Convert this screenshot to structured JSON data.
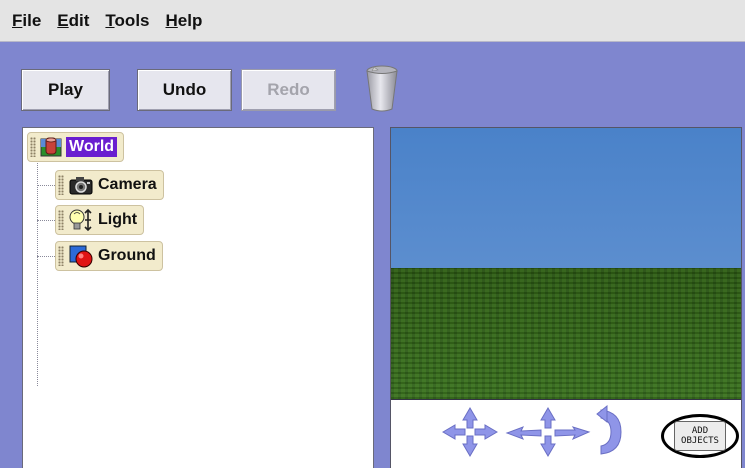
{
  "menubar": {
    "items": [
      "File",
      "Edit",
      "Tools",
      "Help"
    ]
  },
  "toolbar": {
    "play_label": "Play",
    "undo_label": "Undo",
    "redo_label": "Redo",
    "redo_enabled": false,
    "trash_icon": "trash-can-icon"
  },
  "object_tree": {
    "root": {
      "label": "World",
      "icon": "world-icon",
      "selected": true
    },
    "children": [
      {
        "label": "Camera",
        "icon": "camera-icon"
      },
      {
        "label": "Light",
        "icon": "lightbulb-icon"
      },
      {
        "label": "Ground",
        "icon": "ground-icon"
      }
    ]
  },
  "scene_view": {
    "sky_color": "#4f86cb",
    "ground_color": "#2f5f18",
    "controls": [
      "move-camera-icon",
      "move-camera-up-down-icon",
      "turn-camera-icon"
    ],
    "add_objects_label": "ADD OBJECTS"
  },
  "colors": {
    "background": "#7f86cf",
    "selection": "#6a1ed0",
    "tile": "#f2ebcc"
  }
}
